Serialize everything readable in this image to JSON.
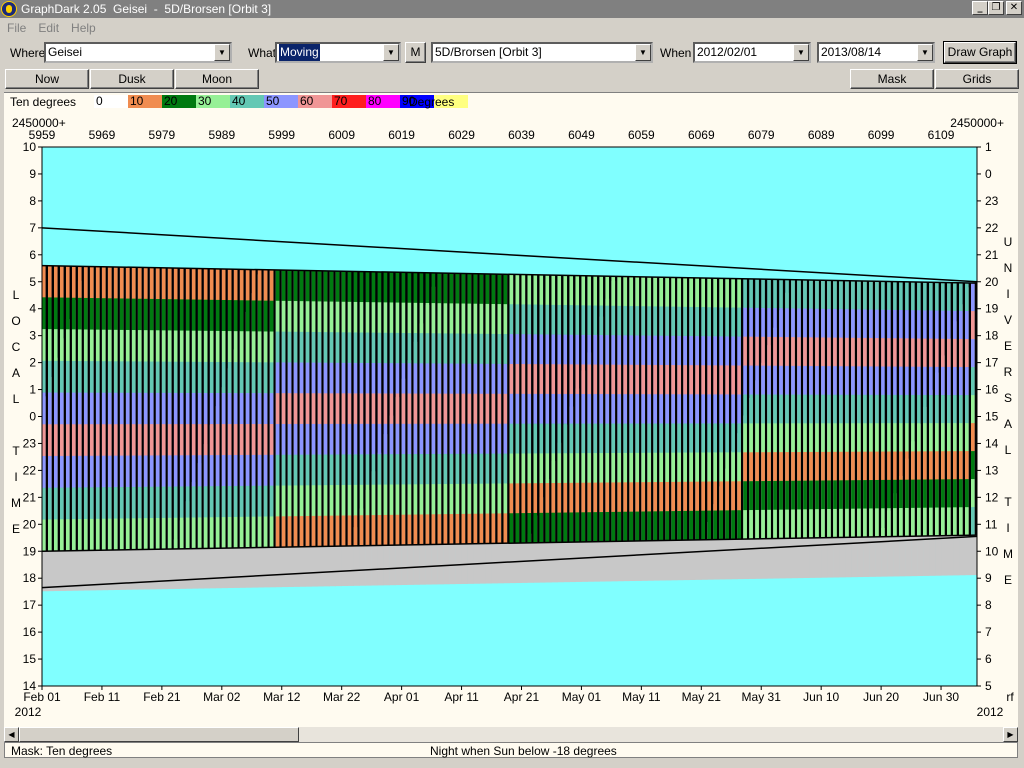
{
  "window": {
    "title": "GraphDark 2.05  Geisei  -  5D/Brorsen [Orbit 3]",
    "controls": [
      "_",
      "❐",
      "✕"
    ]
  },
  "menu": [
    "File",
    "Edit",
    "Help"
  ],
  "toolbar": {
    "where_label": "Where",
    "where_value": "Geisei",
    "what_label": "What",
    "what_value": "Moving",
    "m_button": "M",
    "object_value": "5D/Brorsen [Orbit 3]",
    "when_label": "When",
    "start_date": "2012/02/01",
    "end_date": "2013/08/14",
    "draw_button": "Draw Graph"
  },
  "buttons": {
    "now": "Now",
    "dusk": "Dusk",
    "moon": "Moon",
    "mask": "Mask",
    "grids": "Grids"
  },
  "legend": {
    "left_label": "Ten degrees",
    "right_label": "Degrees",
    "items": [
      {
        "label": "0",
        "color": "#ffffff"
      },
      {
        "label": "10",
        "color": "#f08c50"
      },
      {
        "label": "20",
        "color": "#007a10"
      },
      {
        "label": "30",
        "color": "#96f096"
      },
      {
        "label": "40",
        "color": "#64c8b4"
      },
      {
        "label": "50",
        "color": "#8c96ff"
      },
      {
        "label": "60",
        "color": "#f09696"
      },
      {
        "label": "70",
        "color": "#ff1e1e"
      },
      {
        "label": "80",
        "color": "#ff00ff"
      },
      {
        "label": "90",
        "color": "#0000ff"
      },
      {
        "label": "",
        "color": "#ffff80"
      }
    ]
  },
  "chart_data": {
    "type": "heatmap",
    "top_axis": {
      "prefix": "2450000+",
      "ticks": [
        "5959",
        "5969",
        "5979",
        "5989",
        "5999",
        "6009",
        "6019",
        "6029",
        "6039",
        "6049",
        "6059",
        "6069",
        "6079",
        "6089",
        "6099",
        "6109"
      ]
    },
    "bottom_axis": {
      "ticks": [
        "Feb 01",
        "Feb 11",
        "Feb 21",
        "Mar 02",
        "Mar 12",
        "Mar 22",
        "Apr 01",
        "Apr 11",
        "Apr 21",
        "May 01",
        "May 11",
        "May 21",
        "May 31",
        "Jun 10",
        "Jun 20",
        "Jun 30"
      ],
      "year_left": "2012",
      "year_right": "2012",
      "tail_label": "rf"
    },
    "left_axis": {
      "title": "LOCAL TIME",
      "ticks": [
        "10",
        "9",
        "8",
        "7",
        "6",
        "5",
        "4",
        "3",
        "2",
        "1",
        "0",
        "23",
        "22",
        "21",
        "20",
        "19",
        "18",
        "17",
        "16",
        "15",
        "14"
      ]
    },
    "right_axis": {
      "title": "UNIVERSAL TIME",
      "ticks": [
        "1",
        "0",
        "23",
        "22",
        "21",
        "20",
        "19",
        "18",
        "17",
        "16",
        "15",
        "14",
        "13",
        "12",
        "11",
        "10",
        "9",
        "8",
        "7",
        "6",
        "5"
      ]
    },
    "background_color": "#80ffff",
    "night_color": "#0a0a46",
    "twilight_color": "#0080c0",
    "moon_color": "#c8c8c8",
    "day_count": 156,
    "dusk_local_hour_start": 19.0,
    "dusk_local_hour_end": 19.6,
    "dawn_local_hour_start": 5.6,
    "dawn_local_hour_end": 4.95,
    "object_rise_start": 7.0,
    "object_rise_end": 5.0,
    "object_set_start": 17.65,
    "object_set_end": 19.55
  },
  "status": {
    "mask": "Mask:  Ten degrees",
    "night": "Night when Sun below -18 degrees"
  }
}
